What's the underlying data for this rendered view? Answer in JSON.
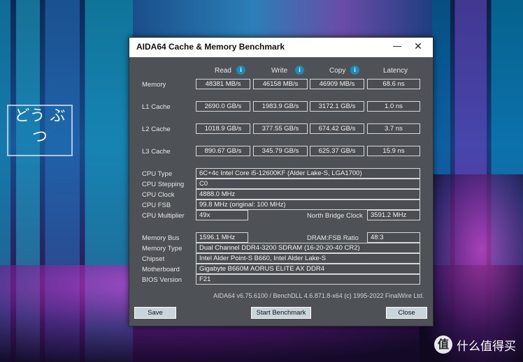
{
  "window": {
    "title": "AIDA64 Cache & Memory Benchmark",
    "minimize_glyph": "—",
    "close_glyph": "✕"
  },
  "columns": {
    "read": "Read",
    "write": "Write",
    "copy": "Copy",
    "latency": "Latency",
    "info_glyph": "i"
  },
  "bench_rows": [
    {
      "label": "Memory",
      "read": "48381 MB/s",
      "write": "46158 MB/s",
      "copy": "46909 MB/s",
      "latency": "68.6 ns"
    },
    {
      "label": "L1 Cache",
      "read": "2690.0 GB/s",
      "write": "1983.9 GB/s",
      "copy": "3172.1 GB/s",
      "latency": "1.0 ns"
    },
    {
      "label": "L2 Cache",
      "read": "1018.9 GB/s",
      "write": "377.55 GB/s",
      "copy": "674.42 GB/s",
      "latency": "3.7 ns"
    },
    {
      "label": "L3 Cache",
      "read": "890.67 GB/s",
      "write": "345.79 GB/s",
      "copy": "625.37 GB/s",
      "latency": "15.9 ns"
    }
  ],
  "cpu": {
    "type_label": "CPU Type",
    "type_value": "6C+4c Intel Core i5-12600KF  (Alder Lake-S, LGA1700)",
    "stepping_label": "CPU Stepping",
    "stepping_value": "C0",
    "clock_label": "CPU Clock",
    "clock_value": "4888.0 MHz",
    "fsb_label": "CPU FSB",
    "fsb_value": "99.8 MHz  (original: 100 MHz)",
    "multiplier_label": "CPU Multiplier",
    "multiplier_value": "49x",
    "nb_clock_label": "North Bridge Clock",
    "nb_clock_value": "3591.2 MHz"
  },
  "memory": {
    "bus_label": "Memory Bus",
    "bus_value": "1596.1 MHz",
    "ratio_label": "DRAM:FSB Ratio",
    "ratio_value": "48:3",
    "type_label": "Memory Type",
    "type_value": "Dual Channel DDR4-3200 SDRAM  (16-20-20-40 CR2)",
    "chipset_label": "Chipset",
    "chipset_value": "Intel Alder Point-S B660, Intel Alder Lake-S",
    "motherboard_label": "Motherboard",
    "motherboard_value": "Gigabyte B660M AORUS ELITE AX DDR4",
    "bios_label": "BIOS Version",
    "bios_value": "F21"
  },
  "footer": "AIDA64 v6.75.6100 / BenchDLL 4.6.871.8-x64  (c) 1995-2022 FinalWire Ltd.",
  "buttons": {
    "save": "Save",
    "start": "Start Benchmark",
    "close": "Close"
  },
  "background": {
    "sign_text": "どう ぶつ",
    "watermark_logo": "值",
    "watermark_text": "什么值得买"
  },
  "colors": {
    "window_bg": "#4e5256",
    "field_border": "#d8d8d8",
    "info_icon": "#1c8bb8",
    "button_bg": "#c8d6dc"
  }
}
